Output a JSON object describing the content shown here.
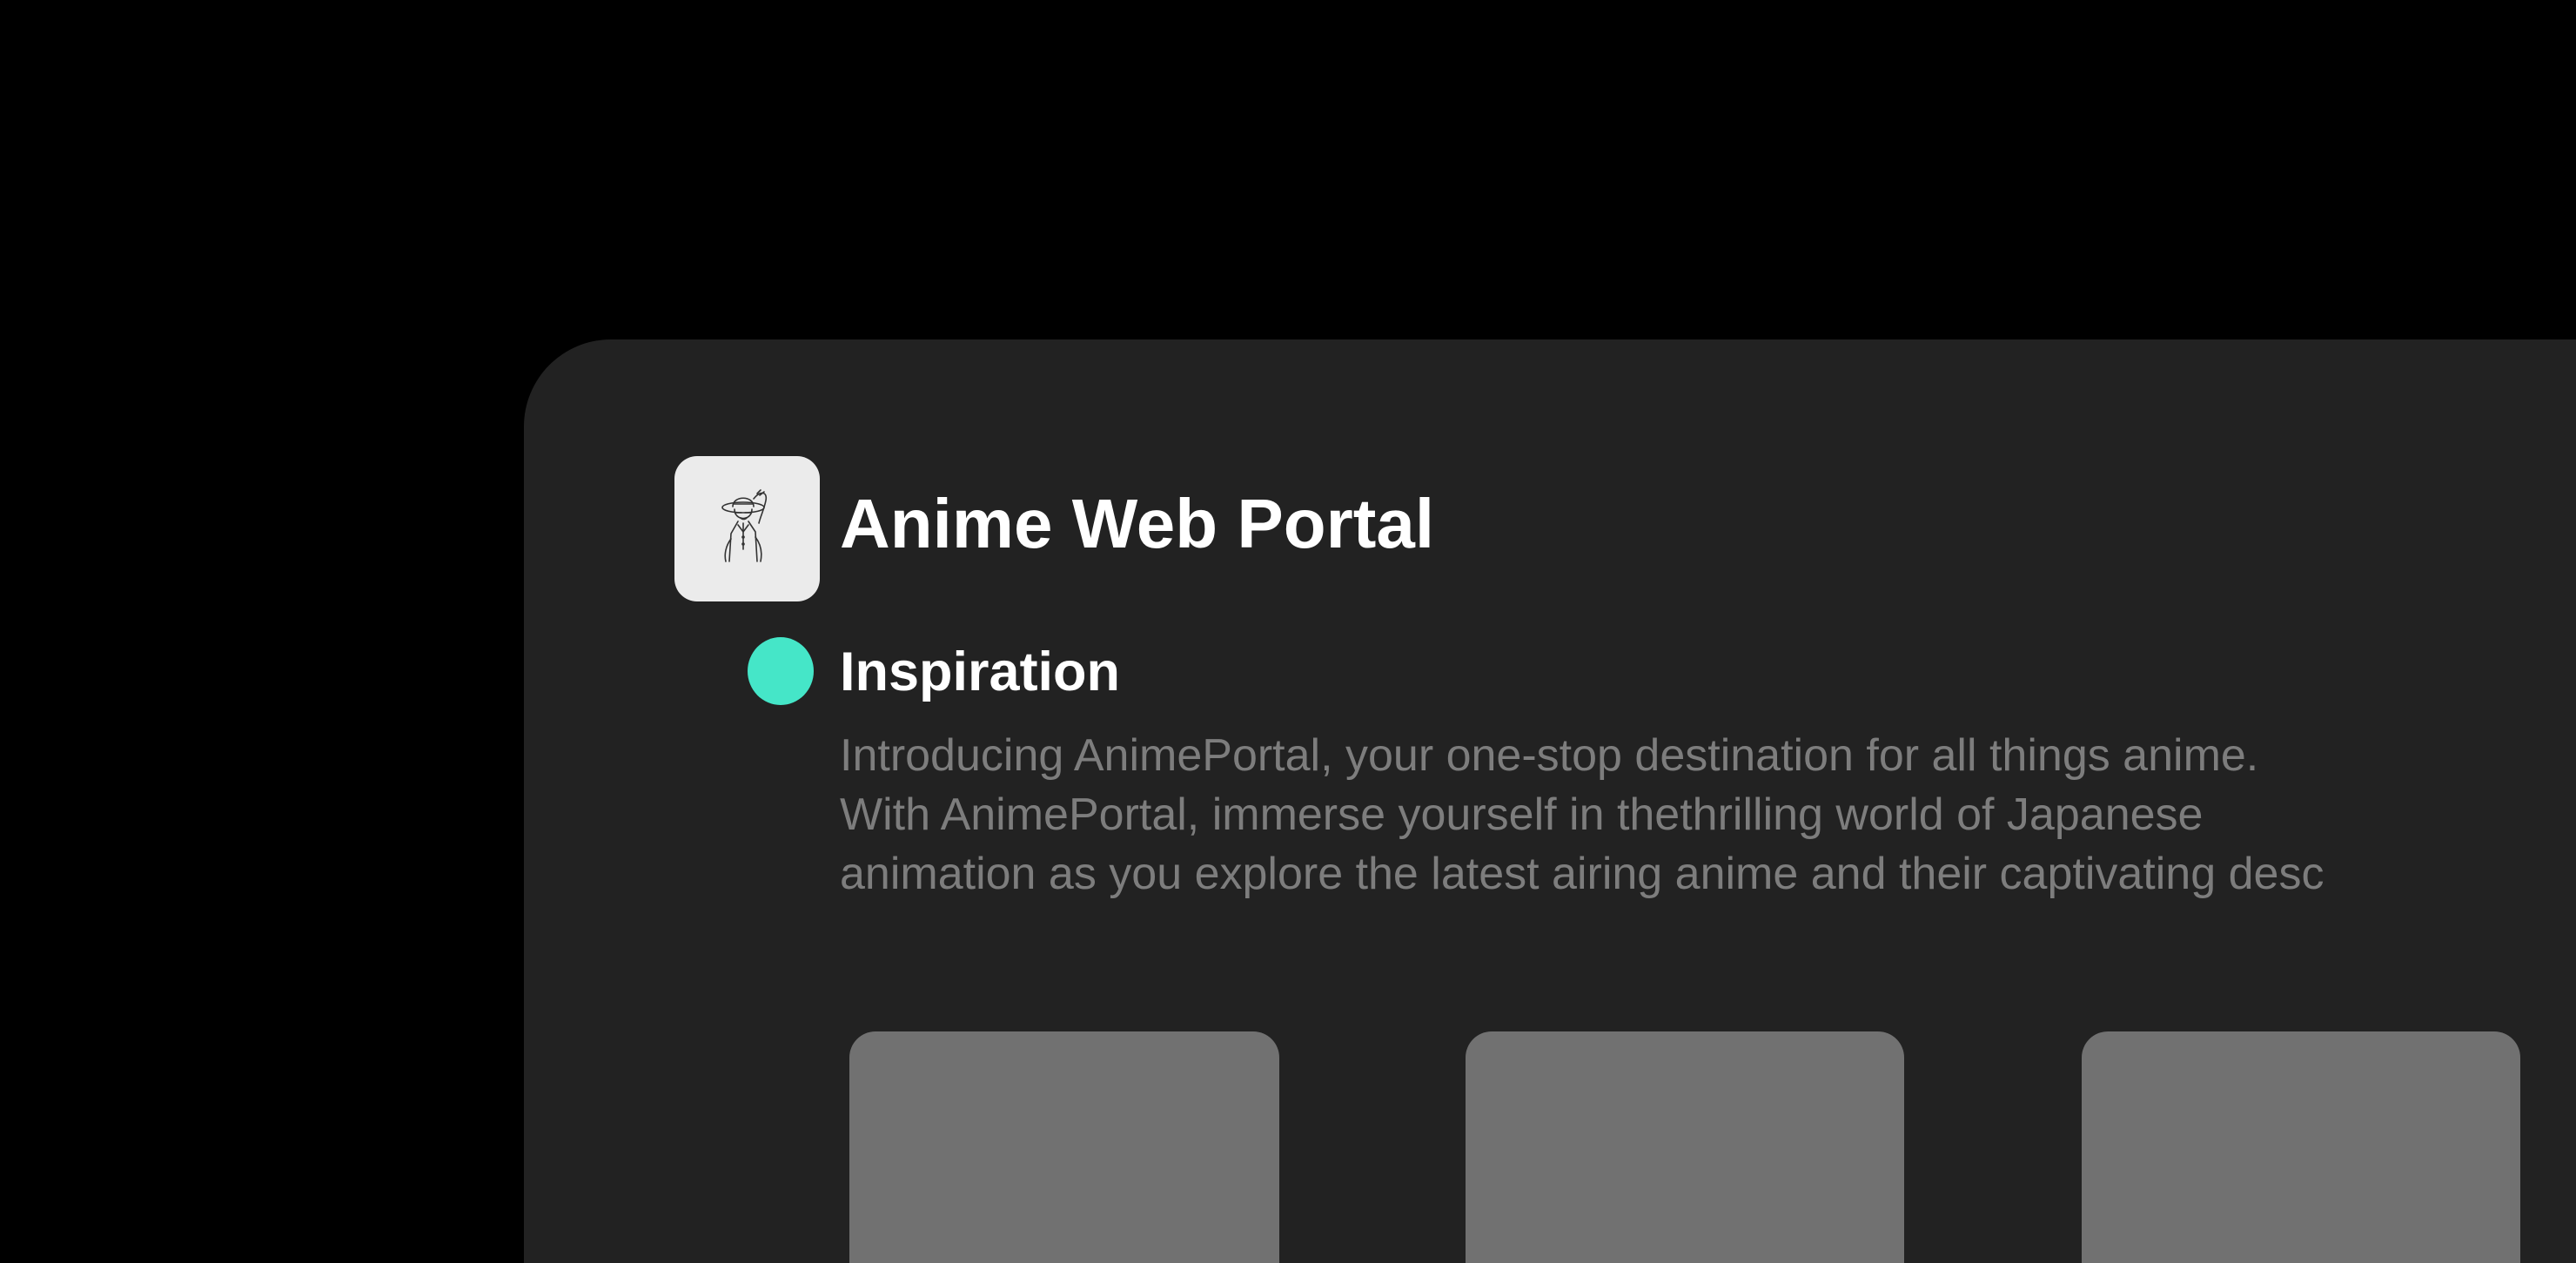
{
  "app": {
    "title": "Anime Web Portal",
    "icon": "anime-character-logo-icon"
  },
  "section": {
    "title": "Inspiration",
    "accent_color": "#45e6c8",
    "description_lines": [
      "Introducing AnimePortal, your one-stop destination for all things anime.",
      "With AnimePortal, immerse yourself in thethrilling world of Japanese",
      "animation as you explore the latest airing anime and their captivating desc"
    ]
  },
  "cards": [
    {
      "color": "#717171"
    },
    {
      "color": "#717171"
    },
    {
      "color": "#717171"
    }
  ]
}
